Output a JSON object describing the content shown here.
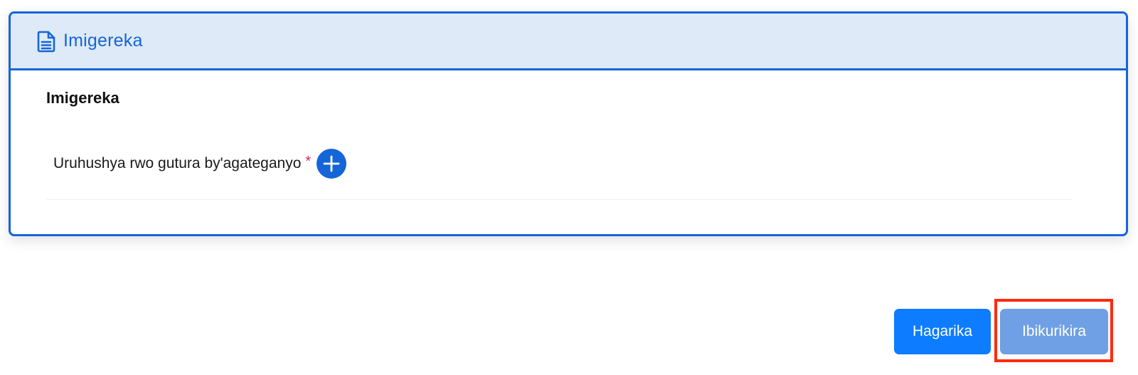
{
  "panel": {
    "header_title": "Imigereka",
    "header_icon": "document-icon",
    "section_title": "Imigereka",
    "field": {
      "label": "Uruhushya rwo gutura by'agateganyo",
      "required_marker": "*",
      "add_icon": "plus-icon"
    }
  },
  "actions": {
    "cancel_label": "Hagarika",
    "next_label": "Ibikurikira"
  },
  "colors": {
    "primary": "#1565d8",
    "header_bg": "#deeaf7",
    "cancel_bg": "#0d7cff",
    "next_bg": "#6f9fe4",
    "required": "#e0245e",
    "highlight": "#ff2a10"
  }
}
